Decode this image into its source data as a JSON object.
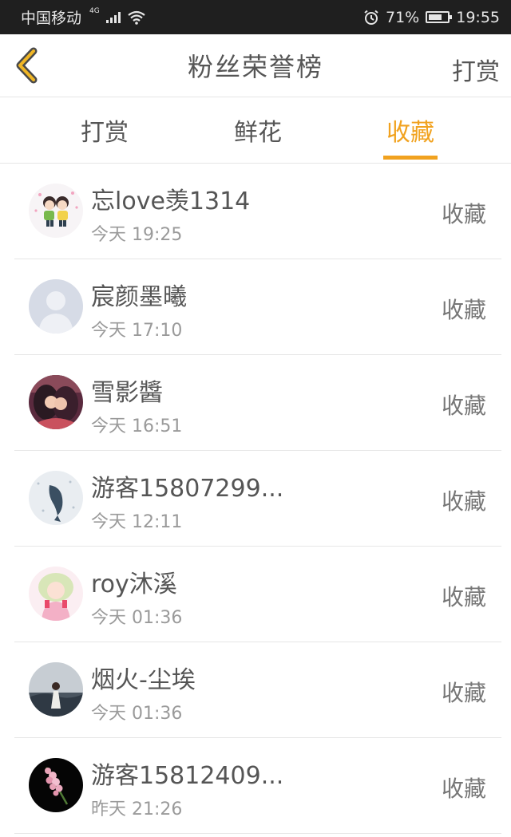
{
  "status_bar": {
    "carrier": "中国移动",
    "network": "4G",
    "battery_percent": "71%",
    "battery_level": 0.71,
    "time": "19:55",
    "icons": [
      "signal-icon",
      "wifi-icon",
      "alarm-icon",
      "battery-icon"
    ]
  },
  "header": {
    "title": "粉丝荣誉榜",
    "back_icon": "chevron-left-icon",
    "right_button": "打赏"
  },
  "tabs": [
    {
      "label": "打赏",
      "active": false
    },
    {
      "label": "鲜花",
      "active": false
    },
    {
      "label": "收藏",
      "active": true
    }
  ],
  "fans": [
    {
      "name": "忘love羡1314",
      "time": "今天 19:25",
      "action": "收藏",
      "avatar": "cartoon-couple-avatar"
    },
    {
      "name": "宸颜墨曦",
      "time": "今天 17:10",
      "action": "收藏",
      "avatar": "default-avatar"
    },
    {
      "name": "雪影醬",
      "time": "今天 16:51",
      "action": "收藏",
      "avatar": "anime-couple-avatar"
    },
    {
      "name": "游客15807299...",
      "time": "今天 12:11",
      "action": "收藏",
      "avatar": "snow-whale-avatar"
    },
    {
      "name": "roy沐溪",
      "time": "今天 01:36",
      "action": "收藏",
      "avatar": "anime-girl-avatar"
    },
    {
      "name": "烟火-尘埃",
      "time": "今天 01:36",
      "action": "收藏",
      "avatar": "seaside-girl-avatar"
    },
    {
      "name": "游客15812409...",
      "time": "昨天 21:26",
      "action": "收藏",
      "avatar": "pink-flower-avatar"
    }
  ],
  "colors": {
    "accent": "#f1a21f",
    "status_bar": "#1f1f1f",
    "text": "#555555",
    "subtext": "#9a9a9a",
    "divider": "#e6e6e6"
  }
}
